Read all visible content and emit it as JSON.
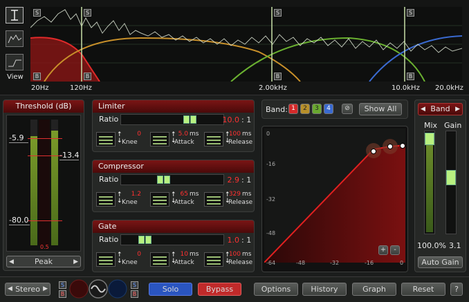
{
  "spectrum": {
    "view_label": "View",
    "freq_labels": [
      "20Hz",
      "120Hz",
      "2.00kHz",
      "10.0kHz",
      "20.0kHz"
    ],
    "solo_marker": "S",
    "bypass_marker": "B"
  },
  "threshold": {
    "title": "Threshold (dB)",
    "left_value": "-5.9",
    "right_value": "-13.4",
    "low_value": "-80.0",
    "meter_readout": "0.5",
    "mode_label": "Peak"
  },
  "limiter": {
    "title": "Limiter",
    "ratio_label": "Ratio",
    "ratio_value": "10.0",
    "ratio_suffix": ": 1",
    "knee_value": "0",
    "knee_label": "Knee",
    "attack_value": "5.0",
    "attack_unit": "ms",
    "attack_label": "Attack",
    "release_value": "100",
    "release_unit": "ms",
    "release_label": "Release"
  },
  "compressor": {
    "title": "Compressor",
    "ratio_label": "Ratio",
    "ratio_value": "2.9",
    "ratio_suffix": ": 1",
    "knee_value": "1.2",
    "knee_label": "Knee",
    "attack_value": "65",
    "attack_unit": "ms",
    "attack_label": "Attack",
    "release_value": "329",
    "release_unit": "ms",
    "release_label": "Release"
  },
  "gate": {
    "title": "Gate",
    "ratio_label": "Ratio",
    "ratio_value": "1.0",
    "ratio_suffix": ": 1",
    "knee_value": "0",
    "knee_label": "Knee",
    "attack_value": "10",
    "attack_unit": "ms",
    "attack_label": "Attack",
    "release_value": "100",
    "release_unit": "ms",
    "release_label": "Release"
  },
  "band_bar": {
    "label": "Band:",
    "bands": [
      "1",
      "2",
      "3",
      "4"
    ],
    "band_colors": [
      "#d42a2a",
      "#b8902a",
      "#6aa830",
      "#3a6ad0"
    ],
    "show_all_label": "Show All"
  },
  "graph": {
    "y_ticks": [
      "0",
      "-16",
      "-32",
      "-48"
    ],
    "x_ticks": [
      "-64",
      "-48",
      "-32",
      "-16",
      "0"
    ],
    "plus_label": "+",
    "minus_label": "-"
  },
  "band_panel": {
    "band_selector": "Band",
    "mix_label": "Mix",
    "gain_label": "Gain",
    "mix_value": "100.0%",
    "gain_value": "3.1",
    "auto_gain_label": "Auto Gain"
  },
  "bottom": {
    "stereo_label": "Stereo",
    "solo_label": "Solo",
    "bypass_label": "Bypass",
    "options_label": "Options",
    "history_label": "History",
    "graph_label": "Graph",
    "reset_label": "Reset",
    "help_label": "?"
  },
  "colors": {
    "band1": "#d42a2a",
    "band2": "#c89a2a",
    "band3": "#6ab030",
    "band4": "#3a6ad0",
    "accent_red": "#7a1515",
    "solo_blue": "#2a55c0",
    "bypass_red": "#c02a2a"
  }
}
